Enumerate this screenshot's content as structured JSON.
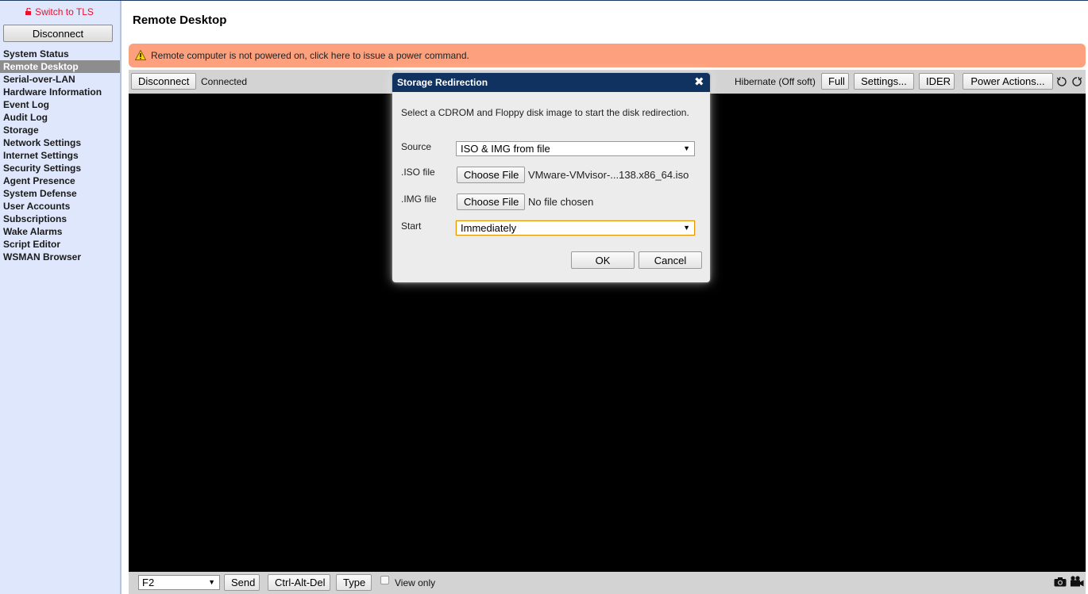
{
  "sidebar": {
    "tls_link": "Switch to TLS",
    "disconnect_label": "Disconnect",
    "nav_items": [
      {
        "label": "System Status"
      },
      {
        "label": "Remote Desktop",
        "active": true
      },
      {
        "label": "Serial-over-LAN"
      },
      {
        "label": "Hardware Information"
      },
      {
        "label": "Event Log"
      },
      {
        "label": "Audit Log"
      },
      {
        "label": "Storage"
      },
      {
        "label": "Network Settings"
      },
      {
        "label": "Internet Settings"
      },
      {
        "label": "Security Settings"
      },
      {
        "label": "Agent Presence"
      },
      {
        "label": "System Defense"
      },
      {
        "label": "User Accounts"
      },
      {
        "label": "Subscriptions"
      },
      {
        "label": "Wake Alarms"
      },
      {
        "label": "Script Editor"
      },
      {
        "label": "WSMAN Browser"
      }
    ]
  },
  "page": {
    "title": "Remote Desktop"
  },
  "alert": {
    "text": "Remote computer is not powered on, click here to issue a power command.",
    "icon": "warning-icon",
    "color": "#fda07d"
  },
  "toolbar": {
    "disconnect_label": "Disconnect",
    "status": "Connected",
    "power_state": "Hibernate (Off soft)",
    "full_label": "Full",
    "settings_label": "Settings...",
    "ider_label": "IDER",
    "power_actions_label": "Power Actions...",
    "icons": [
      "rotate-left-icon",
      "rotate-right-icon"
    ]
  },
  "bottombar": {
    "key_select_value": "F2",
    "send_label": "Send",
    "ctrl_alt_del_label": "Ctrl-Alt-Del",
    "type_label": "Type",
    "view_only_label": "View only",
    "view_only_checked": false,
    "icons": [
      "camera-icon",
      "video-camera-icon"
    ]
  },
  "dialog": {
    "title": "Storage Redirection",
    "description": "Select a CDROM and Floppy disk image to start the disk redirection.",
    "source_label": "Source",
    "source_value": "ISO & IMG from file",
    "iso_label": ".ISO file",
    "iso_button": "Choose File",
    "iso_filename": "VMware-VMvisor-...138.x86_64.iso",
    "img_label": ".IMG file",
    "img_button": "Choose File",
    "img_filename": "No file chosen",
    "start_label": "Start",
    "start_value": "Immediately",
    "ok_label": "OK",
    "cancel_label": "Cancel",
    "titlebar_color": "#0f3261"
  },
  "colors": {
    "sidebar_bg": "#dfe7fd",
    "active_nav_bg": "#8d8d8d",
    "tls_link": "#e8102a",
    "remote_screen": "#000000"
  }
}
